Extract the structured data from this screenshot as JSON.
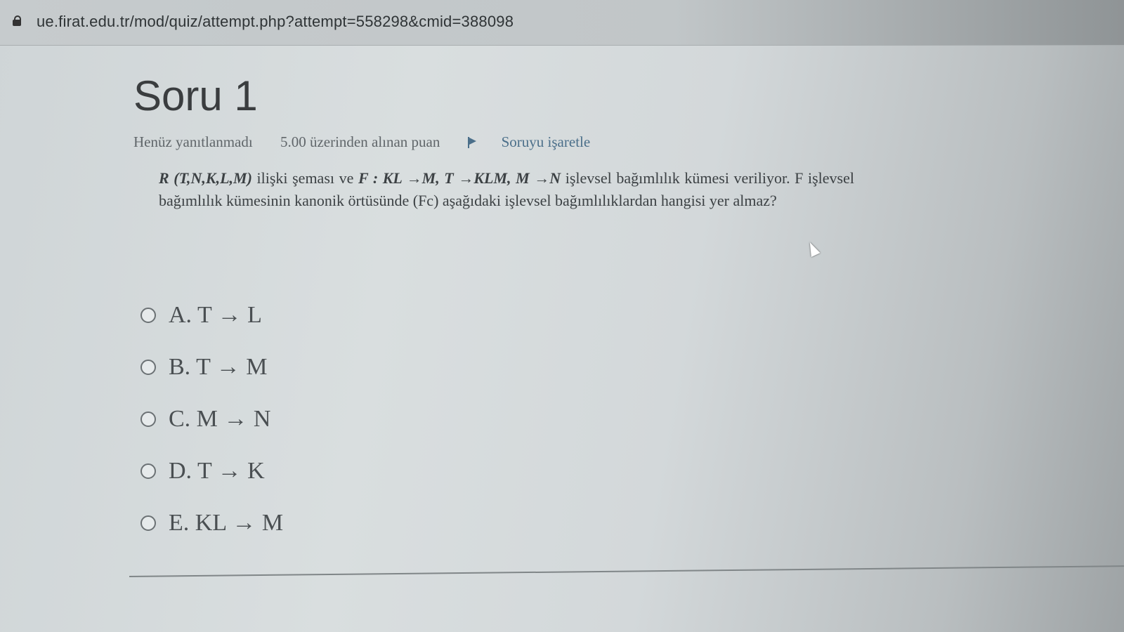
{
  "browser": {
    "url": "ue.firat.edu.tr/mod/quiz/attempt.php?attempt=558298&cmid=388098"
  },
  "question": {
    "title": "Soru 1",
    "status": "Henüz yanıtlanmadı",
    "grade": "5.00 üzerinden alınan puan",
    "flag_label": "Soruyu işaretle",
    "text_schema": "R (T,N,K,L,M)",
    "text_part1": " ilişki şeması ve ",
    "text_fd": "F : KL →M, T →KLM, M →N",
    "text_part2": " işlevsel bağımlılık kümesi veriliyor. F işlevsel bağımlılık kümesinin kanonik örtüsünde (Fc) aşağıdaki işlevsel bağımlılıklardan hangisi yer almaz?"
  },
  "answers": [
    {
      "label": "A. T → L"
    },
    {
      "label": "B. T → M"
    },
    {
      "label": "C. M → N"
    },
    {
      "label": "D. T → K"
    },
    {
      "label": "E. KL → M"
    }
  ]
}
